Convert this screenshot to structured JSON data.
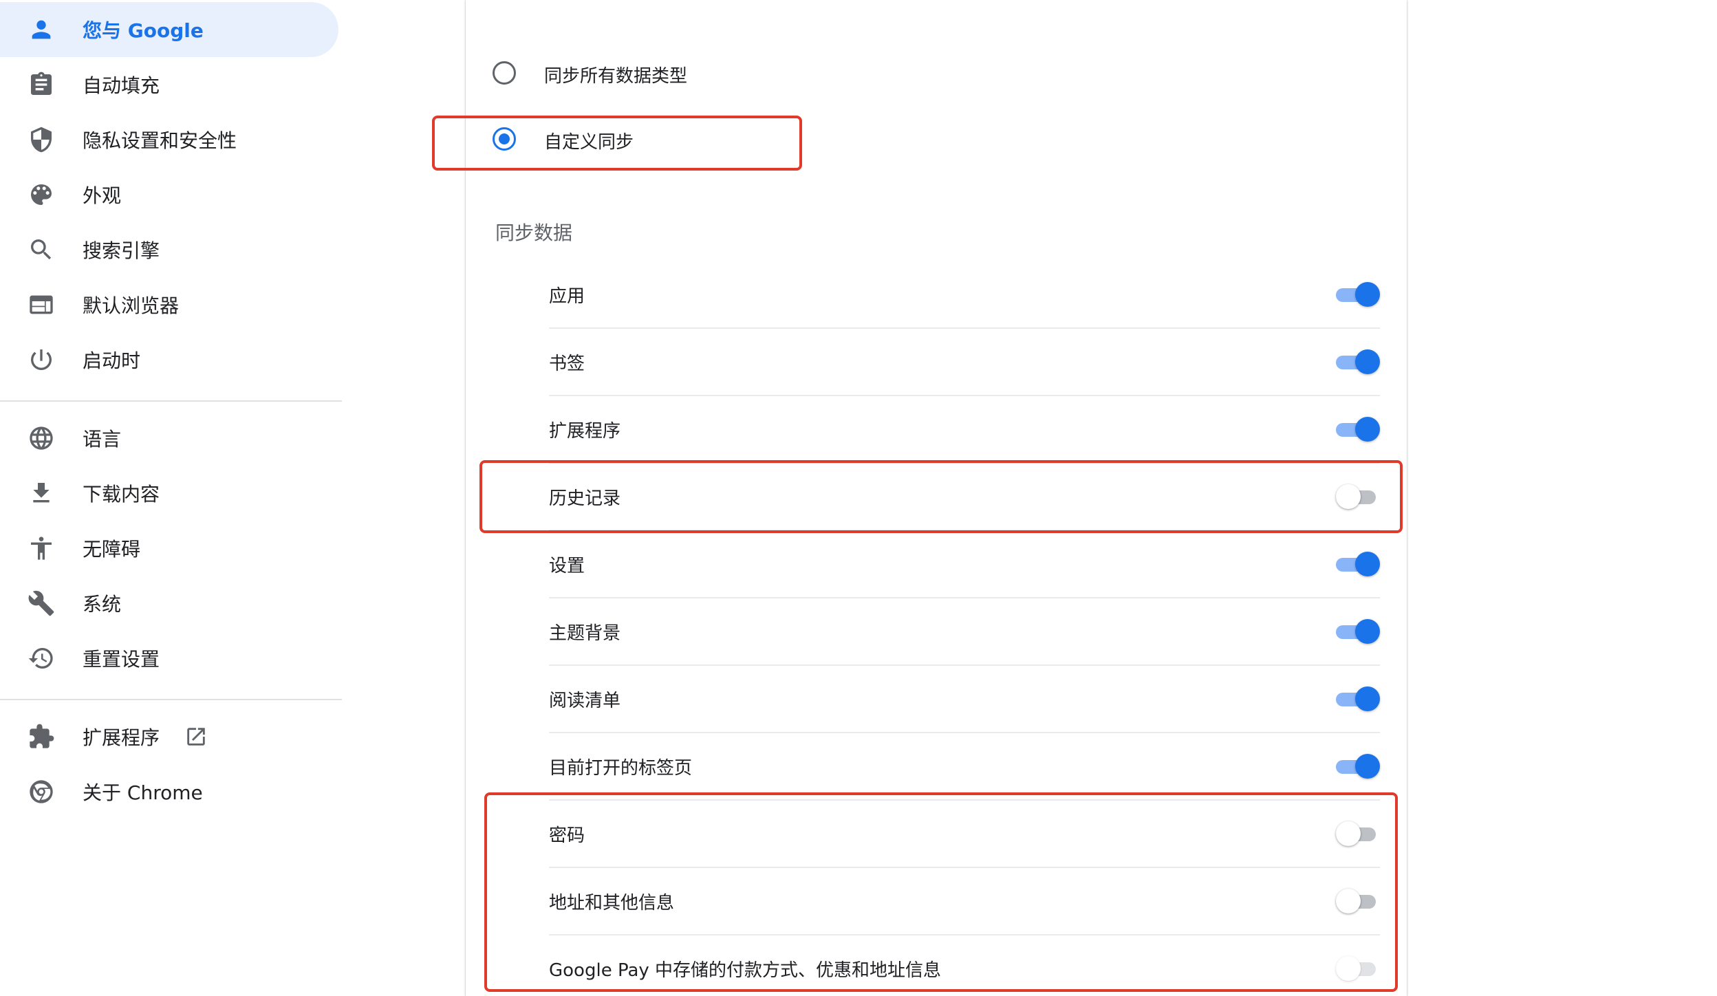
{
  "sidebar": {
    "items": [
      {
        "label": "您与 Google",
        "icon": "person-icon"
      },
      {
        "label": "自动填充",
        "icon": "clipboard-icon"
      },
      {
        "label": "隐私设置和安全性",
        "icon": "shield-icon"
      },
      {
        "label": "外观",
        "icon": "palette-icon"
      },
      {
        "label": "搜索引擎",
        "icon": "search-icon"
      },
      {
        "label": "默认浏览器",
        "icon": "browser-icon"
      },
      {
        "label": "启动时",
        "icon": "power-icon"
      },
      {
        "label": "语言",
        "icon": "globe-icon"
      },
      {
        "label": "下载内容",
        "icon": "download-icon"
      },
      {
        "label": "无障碍",
        "icon": "accessibility-icon"
      },
      {
        "label": "系统",
        "icon": "wrench-icon"
      },
      {
        "label": "重置设置",
        "icon": "history-icon"
      },
      {
        "label": "扩展程序",
        "icon": "puzzle-icon"
      },
      {
        "label": "关于 Chrome",
        "icon": "chrome-icon"
      }
    ],
    "active_index": 0
  },
  "sync": {
    "options": [
      {
        "label": "同步所有数据类型",
        "checked": false
      },
      {
        "label": "自定义同步",
        "checked": true
      }
    ],
    "section_title": "同步数据",
    "rows": [
      {
        "label": "应用",
        "on": true
      },
      {
        "label": "书签",
        "on": true
      },
      {
        "label": "扩展程序",
        "on": true
      },
      {
        "label": "历史记录",
        "on": false
      },
      {
        "label": "设置",
        "on": true
      },
      {
        "label": "主题背景",
        "on": true
      },
      {
        "label": "阅读清单",
        "on": true
      },
      {
        "label": "目前打开的标签页",
        "on": true
      },
      {
        "label": "密码",
        "on": false
      },
      {
        "label": "地址和其他信息",
        "on": false
      },
      {
        "label": "Google Pay 中存储的付款方式、优惠和地址信息",
        "on": false
      }
    ]
  },
  "colors": {
    "accent": "#1a73e8",
    "highlight": "#e03a2a"
  }
}
